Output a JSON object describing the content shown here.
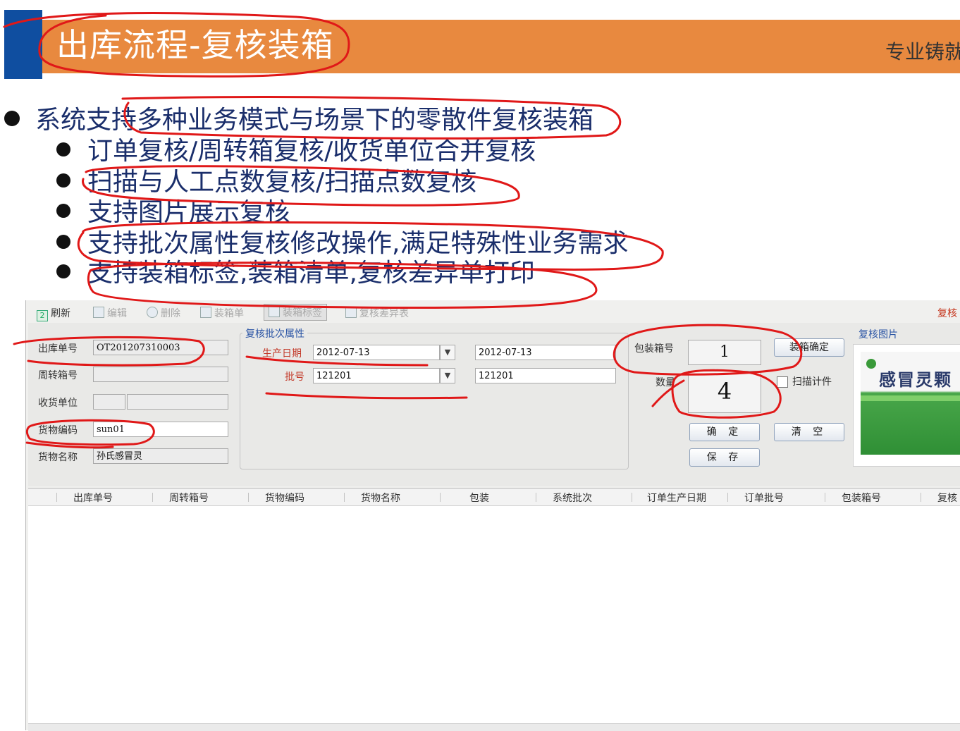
{
  "slide": {
    "title": "出库流程-复核装箱",
    "header_right": "专业铸就",
    "bullet_main": "系统支持多种业务模式与场景下的零散件复核装箱",
    "sub_bullets": [
      "订单复核/周转箱复核/收货单位合并复核",
      "扫描与人工点数复核/扫描点数复核",
      "支持图片展示复核",
      "支持批次属性复核修改操作,满足特殊性业务需求",
      "支持装箱标签,装箱清单,复核差异单打印"
    ]
  },
  "toolbar": {
    "refresh": "刷新",
    "edit": "编辑",
    "delete": "删除",
    "packing_list": "装箱单",
    "packing_label": "装箱标签",
    "diff_sheet": "复核差异表",
    "right_label": "复核"
  },
  "form": {
    "outbound_no_label": "出库单号",
    "outbound_no": "OT201207310003",
    "tote_no_label": "周转箱号",
    "tote_no": "",
    "receiver_label": "收货单位",
    "goods_code_label": "货物编码",
    "goods_code": "sun01",
    "goods_name_label": "货物名称",
    "goods_name": "孙氏感冒灵"
  },
  "batch": {
    "group_title": "复核批次属性",
    "prod_date_label": "生产日期",
    "prod_date_select": "2012-07-13",
    "prod_date_value": "2012-07-13",
    "lot_label": "批号",
    "lot_select": "121201",
    "lot_value": "121201"
  },
  "packing": {
    "box_no_label": "包装箱号",
    "box_no": "1",
    "box_confirm_button": "装箱确定",
    "qty_label": "数量",
    "qty": "4",
    "scan_count_label": "扫描计件",
    "confirm_button": "确 定",
    "clear_button": "清 空",
    "save_button": "保 存"
  },
  "photo": {
    "title": "复核图片",
    "product_text": "感冒灵颗"
  },
  "grid": {
    "columns": [
      "出库单号",
      "周转箱号",
      "货物编码",
      "货物名称",
      "包装",
      "系统批次",
      "订单生产日期",
      "订单批号",
      "包装箱号",
      "复核"
    ]
  },
  "colors": {
    "header_orange": "#e8893f",
    "header_blue": "#0f4ea0",
    "annotation_red": "#e01818",
    "bullet_text": "#1a2e6b"
  }
}
